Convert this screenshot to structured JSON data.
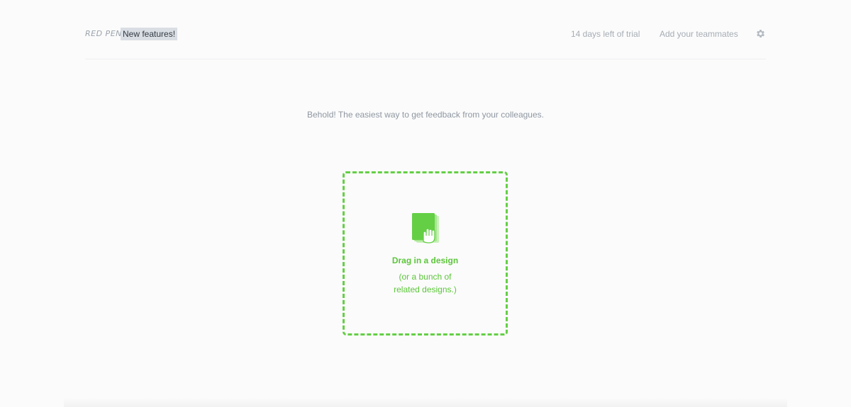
{
  "header": {
    "logo": "RED PEN",
    "new_features": "New features!",
    "trial": "14 days left of trial",
    "add_teammates": "Add your teammates",
    "settings_icon": "gear-icon"
  },
  "main": {
    "tagline": "Behold! The easiest way to get feedback from your colleagues.",
    "dropzone": {
      "icon": "document-drag-hand-icon",
      "title": "Drag in a design",
      "subtitle_line1": "(or a bunch of",
      "subtitle_line2": "related designs.)"
    }
  },
  "colors": {
    "accent_green": "#64cf45",
    "text_muted": "#a6adb5",
    "background": "#fbfbfb"
  }
}
